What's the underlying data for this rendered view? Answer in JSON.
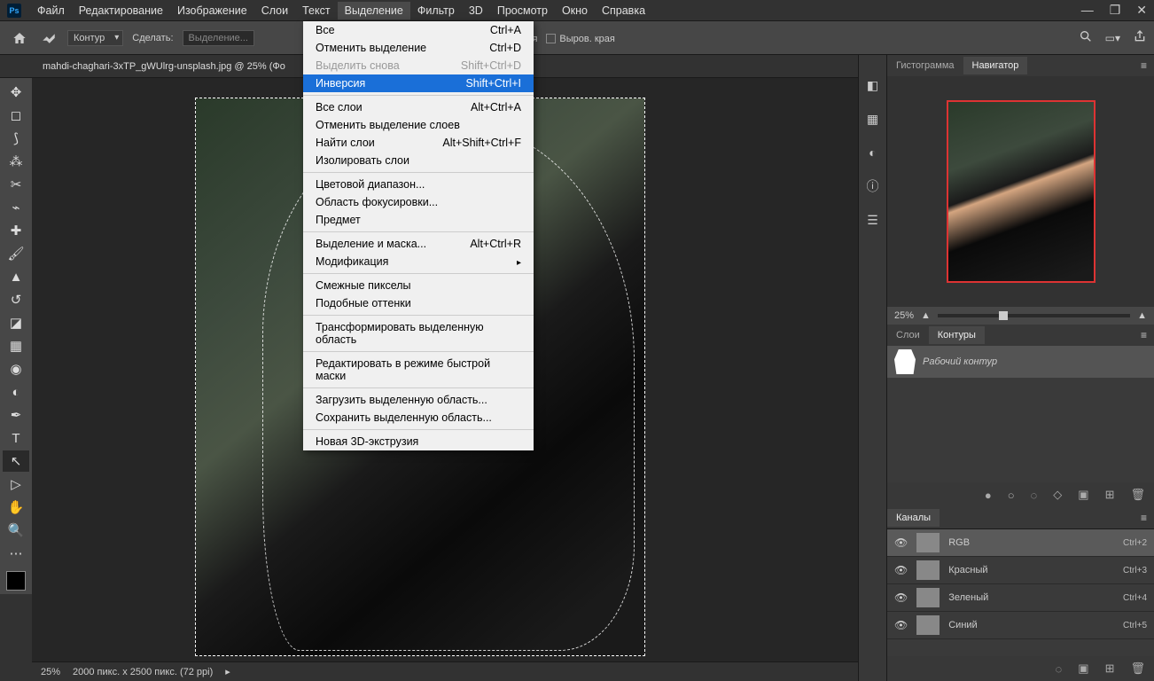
{
  "menubar": [
    "Файл",
    "Редактирование",
    "Изображение",
    "Слои",
    "Текст",
    "Выделение",
    "Фильтр",
    "3D",
    "Просмотр",
    "Окно",
    "Справка"
  ],
  "active_menu_index": 5,
  "dropdown": {
    "groups": [
      [
        {
          "label": "Все",
          "shortcut": "Ctrl+A"
        },
        {
          "label": "Отменить выделение",
          "shortcut": "Ctrl+D"
        },
        {
          "label": "Выделить снова",
          "shortcut": "Shift+Ctrl+D",
          "disabled": true
        },
        {
          "label": "Инверсия",
          "shortcut": "Shift+Ctrl+I",
          "highlighted": true
        }
      ],
      [
        {
          "label": "Все слои",
          "shortcut": "Alt+Ctrl+A"
        },
        {
          "label": "Отменить выделение слоев",
          "shortcut": ""
        },
        {
          "label": "Найти слои",
          "shortcut": "Alt+Shift+Ctrl+F"
        },
        {
          "label": "Изолировать слои",
          "shortcut": ""
        }
      ],
      [
        {
          "label": "Цветовой диапазон...",
          "shortcut": ""
        },
        {
          "label": "Область фокусировки...",
          "shortcut": ""
        },
        {
          "label": "Предмет",
          "shortcut": ""
        }
      ],
      [
        {
          "label": "Выделение и маска...",
          "shortcut": "Alt+Ctrl+R"
        },
        {
          "label": "Модификация",
          "shortcut": "",
          "submenu": true
        }
      ],
      [
        {
          "label": "Смежные пикселы",
          "shortcut": ""
        },
        {
          "label": "Подобные оттенки",
          "shortcut": ""
        }
      ],
      [
        {
          "label": "Трансформировать выделенную область",
          "shortcut": ""
        }
      ],
      [
        {
          "label": "Редактировать в режиме быстрой маски",
          "shortcut": ""
        }
      ],
      [
        {
          "label": "Загрузить выделенную область...",
          "shortcut": ""
        },
        {
          "label": "Сохранить выделенную область...",
          "shortcut": ""
        }
      ],
      [
        {
          "label": "Новая 3D-экструзия",
          "shortcut": ""
        }
      ]
    ]
  },
  "options": {
    "kontur": "Контур",
    "make_label": "Сделать:",
    "make_value": "Выделение...",
    "optim_partial": "тимизация",
    "edge_label": "Выров. края"
  },
  "doc_tab": "mahdi-chaghari-3xTP_gWUlrg-unsplash.jpg @ 25% (Фо",
  "panels": {
    "hist_tab": "Гистограмма",
    "nav_tab": "Навигатор",
    "nav_zoom": "25%",
    "layers_tab": "Слои",
    "paths_tab": "Контуры",
    "work_path": "Рабочий контур",
    "channels_tab": "Каналы",
    "channels": [
      {
        "name": "RGB",
        "shortcut": "Ctrl+2",
        "active": true
      },
      {
        "name": "Красный",
        "shortcut": "Ctrl+3"
      },
      {
        "name": "Зеленый",
        "shortcut": "Ctrl+4"
      },
      {
        "name": "Синий",
        "shortcut": "Ctrl+5"
      }
    ]
  },
  "status": {
    "zoom": "25%",
    "info": "2000 пикс. x 2500 пикс. (72 ppi)"
  }
}
